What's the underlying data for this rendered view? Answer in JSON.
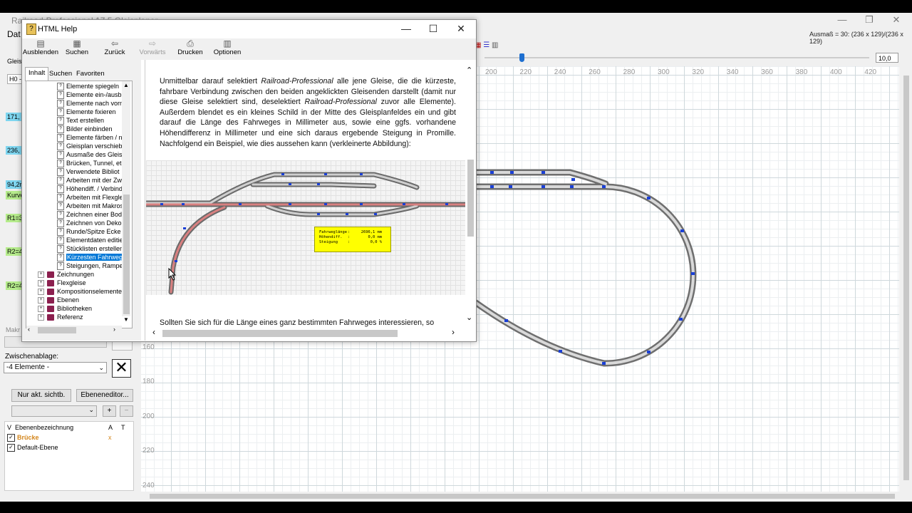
{
  "app": {
    "title": "Railroad-Professional 17.5 Gleisplaner",
    "menu_first": "Dat",
    "ausmass": "Ausmaß = 30: (236 x 129)/(236 x 129)",
    "zoom_value": "10,0",
    "ruler_top": [
      "200",
      "220",
      "240",
      "260",
      "280",
      "300",
      "320",
      "340",
      "360",
      "380",
      "400",
      "420"
    ],
    "ruler_left": [
      "160",
      "180",
      "200",
      "220",
      "240"
    ],
    "window_buttons": [
      "—",
      "❐",
      "✕"
    ]
  },
  "left_panel": {
    "tab_label": "Gleis",
    "h0_label": "H0 -",
    "track_labels": [
      "171,",
      "236,",
      "94,2r",
      "Kurve",
      "R1=3",
      "R2=4",
      "R2=4"
    ],
    "makro_label": "Makr",
    "zwischenablage_label": "Zwischenablage:",
    "zwischenablage_value": "-4 Elemente -",
    "clear_glyph": "✕",
    "btn_visible": "Nur akt. sichtb.",
    "btn_layer_editor": "Ebeneneditor...",
    "btn_plus": "+",
    "btn_minus": "−",
    "layers_header": {
      "v": "V",
      "name": "Ebenenbezeichnung",
      "a": "A",
      "t": "T"
    },
    "layers": [
      {
        "name": "Brücke",
        "a": "x",
        "checked": "✓",
        "color": "#d4861c"
      },
      {
        "name": "Default-Ebene",
        "a": "",
        "checked": "✓",
        "color": "#000000"
      }
    ]
  },
  "help": {
    "title": "HTML Help",
    "icon_glyph": "?",
    "window_buttons": [
      "—",
      "☐",
      "✕"
    ],
    "toolbar": [
      {
        "label": "Ausblenden",
        "icon": "▤"
      },
      {
        "label": "Suchen",
        "icon": "▦"
      },
      {
        "label": "Zurück",
        "icon": "⇦"
      },
      {
        "label": "Vorwärts",
        "icon": "⇨"
      },
      {
        "label": "Drucken",
        "icon": "⎙"
      },
      {
        "label": "Optionen",
        "icon": "▥"
      }
    ],
    "nav_tabs": [
      "Inhalt",
      "Suchen",
      "Favoriten"
    ],
    "tree_pages": [
      "Elemente spiegeln",
      "Elemente ein-/ausb",
      "Elemente nach vorn",
      "Elemente fixieren",
      "Text erstellen",
      "Bilder einbinden",
      "Elemente färben / n",
      "Gleisplan verschieb",
      "Ausmaße des Gleis",
      "Brücken, Tunnel, etc",
      "Verwendete Bibliot",
      "Arbeiten mit der Zwi",
      "Höhendiff. / Verbind",
      "Arbeiten mit Flexgle",
      "Arbeiten mit Makros",
      "Zeichnen einer Bod",
      "Zeichnen von Deko",
      "Runde/Spitze Ecke",
      "Elementdaten editie",
      "Stücklisten erstellen",
      "Kürzesten Fahrweg",
      "Steigungen, Rampe"
    ],
    "tree_selected": "Kürzesten Fahrweg",
    "tree_books": [
      "Zeichnungen",
      "Flexgleise",
      "Kompositionselemente",
      "Ebenen",
      "Bibliotheken",
      "Referenz"
    ],
    "para1": {
      "t1": "Unmittelbar darauf selektiert ",
      "em1": "Railroad-Professional",
      "t2": " alle jene Gleise, die die kürzeste, fahrbare Verbindung zwischen den beiden angeklickten Gleisenden darstellt (damit nur diese Gleise selektiert sind, deselektiert ",
      "em2": "Railroad-Professional",
      "t3": " zuvor alle Elemente). Außerdem blendet es ein kleines Schild in der Mitte des Gleisplanfeldes ein und gibt darauf die Länge des Fahrweges in Millimeter aus, sowie eine ggfs. vorhandene Höhendifferenz in Millimeter und eine sich daraus ergebende Steigung in Promille. Nachfolgend ein Beispiel, wie dies aussehen kann (verkleinerte Abbildung):"
    },
    "para2": "Sollten Sie sich für die Länge eines ganz bestimmten Fahrweges interessieren, so",
    "infobox": [
      {
        "label": "Fahrweglänge",
        "value": "2696,1 mm"
      },
      {
        "label": "Höhendiff.",
        "value": "0,0 mm"
      },
      {
        "label": "Steigung",
        "value": "0,0 %"
      }
    ]
  }
}
